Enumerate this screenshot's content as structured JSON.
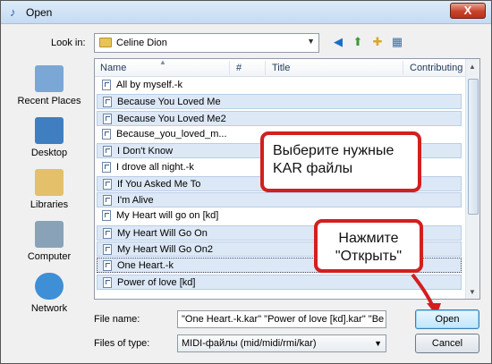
{
  "window": {
    "title": "Open"
  },
  "lookin": {
    "label": "Look in:",
    "value": "Celine Dion"
  },
  "places": [
    {
      "label": "Recent Places",
      "color": "#7ba7d6"
    },
    {
      "label": "Desktop",
      "color": "#3f7fc1"
    },
    {
      "label": "Libraries",
      "color": "#e3c069"
    },
    {
      "label": "Computer",
      "color": "#8aa2b8"
    },
    {
      "label": "Network",
      "color": "#3e8fd6"
    }
  ],
  "columns": [
    "Name",
    "#",
    "Title",
    "Contributing"
  ],
  "files": [
    {
      "name": "All by myself.-k",
      "selected": false
    },
    {
      "name": "Because You Loved Me",
      "selected": true
    },
    {
      "name": "Because You Loved Me2",
      "selected": true
    },
    {
      "name": "Because_you_loved_m...",
      "selected": false
    },
    {
      "name": "I Don't Know",
      "selected": true
    },
    {
      "name": "I drove all night.-k",
      "selected": false
    },
    {
      "name": "If You Asked Me To",
      "selected": true
    },
    {
      "name": "I'm Alive",
      "selected": true
    },
    {
      "name": "My Heart will go on [kd]",
      "selected": false
    },
    {
      "name": "My Heart Will Go On",
      "selected": true
    },
    {
      "name": "My Heart Will Go On2",
      "selected": true
    },
    {
      "name": "One Heart.-k",
      "selected": true
    },
    {
      "name": "Power of love [kd]",
      "selected": true
    }
  ],
  "callouts": {
    "select_kar": "Выберите нужные KAR файлы",
    "press_open": "Нажмите \"Открыть\""
  },
  "filename": {
    "label": "File name:",
    "value": "\"One Heart.-k.kar\" \"Power of love [kd].kar\" \"Be"
  },
  "filetype": {
    "label": "Files of type:",
    "value": "MIDI-файлы (mid/midi/rmi/kar)"
  },
  "buttons": {
    "open": "Open",
    "cancel": "Cancel",
    "close": "X"
  },
  "colors": {
    "callout_border": "#d21f1f",
    "selection": "#dde8f6"
  }
}
